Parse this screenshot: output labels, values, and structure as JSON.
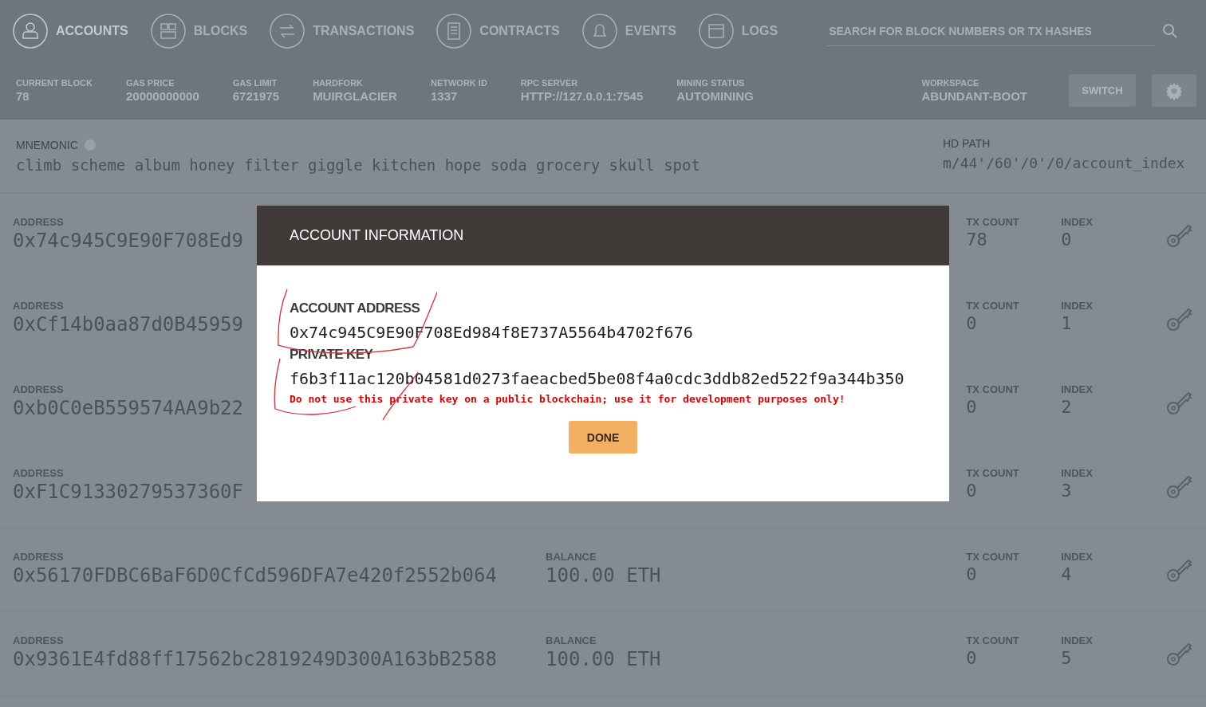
{
  "nav": [
    {
      "label": "ACCOUNTS",
      "selected": true
    },
    {
      "label": "BLOCKS",
      "selected": false
    },
    {
      "label": "TRANSACTIONS",
      "selected": false
    },
    {
      "label": "CONTRACTS",
      "selected": false
    },
    {
      "label": "EVENTS",
      "selected": false
    },
    {
      "label": "LOGS",
      "selected": false
    }
  ],
  "search": {
    "placeholder": "SEARCH FOR BLOCK NUMBERS OR TX HASHES"
  },
  "stats": [
    {
      "label": "CURRENT BLOCK",
      "value": "78"
    },
    {
      "label": "GAS PRICE",
      "value": "20000000000"
    },
    {
      "label": "GAS LIMIT",
      "value": "6721975"
    },
    {
      "label": "HARDFORK",
      "value": "MUIRGLACIER"
    },
    {
      "label": "NETWORK ID",
      "value": "1337"
    },
    {
      "label": "RPC SERVER",
      "value": "HTTP://127.0.0.1:7545"
    },
    {
      "label": "MINING STATUS",
      "value": "AUTOMINING"
    }
  ],
  "workspace": {
    "label": "WORKSPACE",
    "value": "ABUNDANT-BOOT"
  },
  "switch_button": "SWITCH",
  "mnemonic": {
    "label": "MNEMONIC",
    "words": "climb scheme album honey filter giggle kitchen hope soda grocery skull spot"
  },
  "hd_path": {
    "label": "HD PATH",
    "value": "m/44'/60'/0'/0/account_index"
  },
  "accounts": [
    {
      "address_label": "ADDRESS",
      "address": "0x74c945C9E90F708Ed9",
      "tx_count_label": "TX COUNT",
      "tx_count": "78",
      "index_label": "INDEX",
      "index": "0"
    },
    {
      "address_label": "ADDRESS",
      "address": "0xCf14b0aa87d0B45959",
      "tx_count_label": "TX COUNT",
      "tx_count": "0",
      "index_label": "INDEX",
      "index": "1"
    },
    {
      "address_label": "ADDRESS",
      "address": "0xb0C0eB559574AA9b22",
      "tx_count_label": "TX COUNT",
      "tx_count": "0",
      "index_label": "INDEX",
      "index": "2"
    },
    {
      "address_label": "ADDRESS",
      "address": "0xF1C91330279537360F",
      "tx_count_label": "TX COUNT",
      "tx_count": "0",
      "index_label": "INDEX",
      "index": "3"
    },
    {
      "address_label": "ADDRESS",
      "address": "0x56170FDBC6BaF6D0CfCd596DFA7e420f2552b064",
      "balance_label": "BALANCE",
      "balance": "100.00 ETH",
      "tx_count_label": "TX COUNT",
      "tx_count": "0",
      "index_label": "INDEX",
      "index": "4"
    },
    {
      "address_label": "ADDRESS",
      "address": "0x9361E4fd88ff17562bc2819249D300A163bB2588",
      "balance_label": "BALANCE",
      "balance": "100.00 ETH",
      "tx_count_label": "TX COUNT",
      "tx_count": "0",
      "index_label": "INDEX",
      "index": "5"
    }
  ],
  "dialog": {
    "title": "ACCOUNT INFORMATION",
    "fields": [
      {
        "label": "ACCOUNT ADDRESS",
        "value": "0x74c945C9E90F708Ed984f8E737A5564b4702f676"
      },
      {
        "label": "PRIVATE KEY",
        "value": "f6b3f11ac120b04581d0273faeacbed5be08f4a0cdc3ddb82ed522f9a344b350"
      }
    ],
    "warning": "Do not use this private key on a public blockchain; use it for development purposes only!",
    "button": "DONE"
  }
}
